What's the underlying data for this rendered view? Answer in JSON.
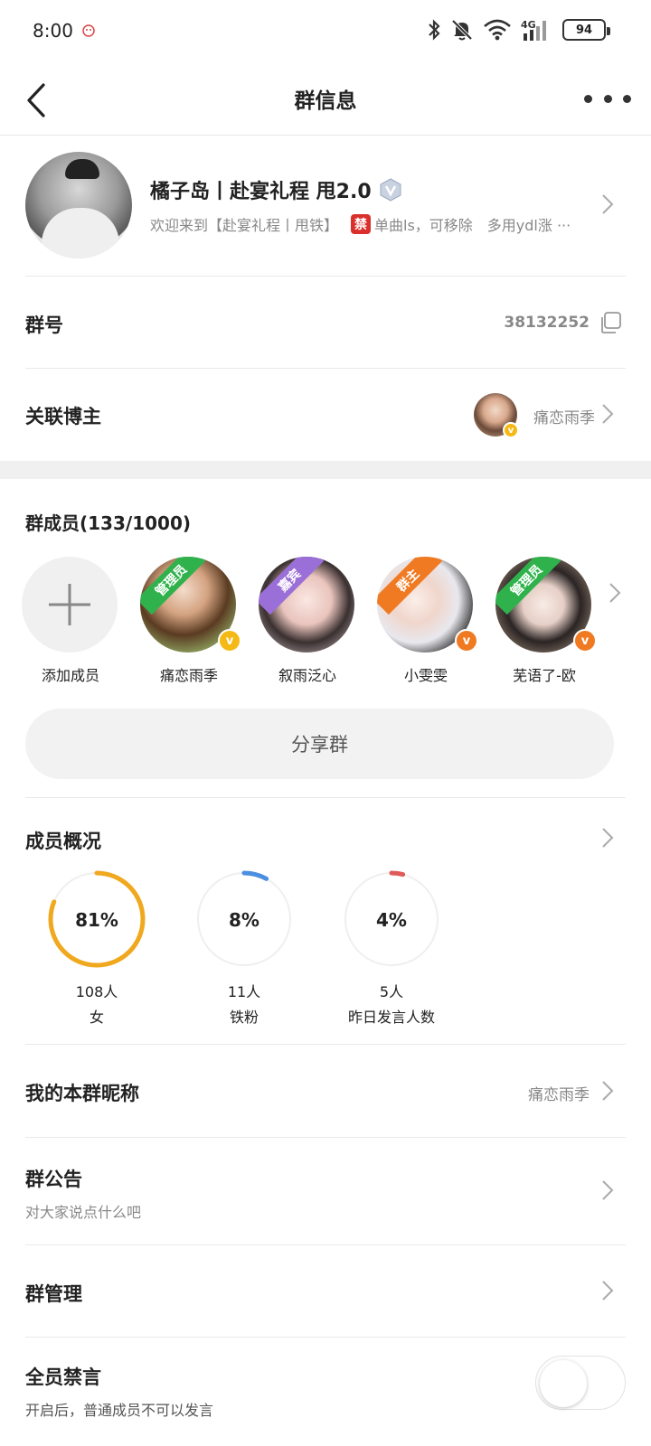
{
  "status_bar": {
    "time": "8:00",
    "battery": "94",
    "icons": [
      "bluetooth-icon",
      "mute-bell-icon",
      "wifi-icon",
      "4g-signal-icon",
      "battery-icon"
    ]
  },
  "nav": {
    "title": "群信息"
  },
  "group": {
    "name": "橘子岛丨赴宴礼程 甩2.0",
    "desc_prefix": "欢迎来到【赴宴礼程丨甩铁】",
    "ban_tag": "禁",
    "desc_suffix": "单曲ls，可移除　多用ydl涨 ···"
  },
  "group_number": {
    "label": "群号",
    "value": "38132252"
  },
  "linked_blogger": {
    "label": "关联博主",
    "value": "痛恋雨季"
  },
  "members": {
    "title": "群成员(133/1000)",
    "add_label": "添加成员",
    "list": [
      {
        "name": "痛恋雨季",
        "role": "管理员",
        "role_color": "#2fb24c",
        "badge_color": "#f5b916"
      },
      {
        "name": "叙雨泛心",
        "role": "嘉宾",
        "role_color": "#9b6fd8",
        "badge_color": ""
      },
      {
        "name": "小雯雯",
        "role": "群主",
        "role_color": "#f07a22",
        "badge_color": "#f07a22"
      },
      {
        "name": "芜语了-欧",
        "role": "管理员",
        "role_color": "#2fb24c",
        "badge_color": "#f07a22"
      }
    ]
  },
  "share": {
    "label": "分享群"
  },
  "overview": {
    "title": "成员概况",
    "stats": [
      {
        "percent": "81%",
        "fraction": 0.81,
        "count": "108人",
        "label": "女",
        "color": "#f0a81e"
      },
      {
        "percent": "8%",
        "fraction": 0.08,
        "count": "11人",
        "label": "铁粉",
        "color": "#4a8fe0"
      },
      {
        "percent": "4%",
        "fraction": 0.04,
        "count": "5人",
        "label": "昨日发言人数",
        "color": "#e05a5a"
      }
    ]
  },
  "nickname": {
    "label": "我的本群昵称",
    "value": "痛恋雨季"
  },
  "announcement": {
    "label": "群公告",
    "sub": "对大家说点什么吧"
  },
  "management": {
    "label": "群管理"
  },
  "mute_all": {
    "label": "全员禁言",
    "sub": "开启后，普通成员不可以发言",
    "enabled": false
  }
}
